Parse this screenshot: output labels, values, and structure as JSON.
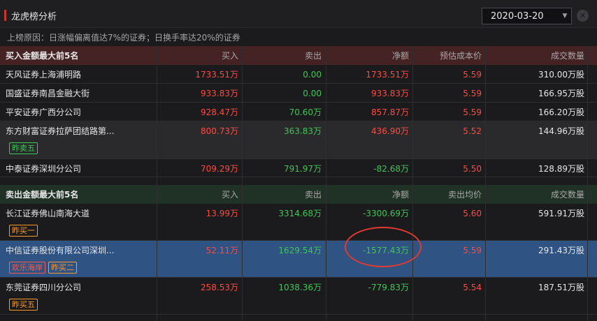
{
  "window": {
    "title": "龙虎榜分析",
    "date": "2020-03-20",
    "close_icon": "close-icon"
  },
  "reason": "上榜原因：日涨幅偏离值达7%的证券；日换手率达20%的证券",
  "buy_section": {
    "headers": [
      "买入金额最大前5名",
      "买入",
      "卖出",
      "净额",
      "预估成本价",
      "成交数量"
    ],
    "rows": [
      {
        "name": "天风证券上海浦明路",
        "buy": "1733.51万",
        "sell": "0.00",
        "net": "1733.51万",
        "price": "5.59",
        "volume": "310.00万股",
        "tags": []
      },
      {
        "name": "国盛证券南昌金融大街",
        "buy": "933.83万",
        "sell": "0.00",
        "net": "933.83万",
        "price": "5.59",
        "volume": "166.95万股",
        "tags": []
      },
      {
        "name": "平安证券广西分公司",
        "buy": "928.47万",
        "sell": "70.60万",
        "net": "857.87万",
        "price": "5.59",
        "volume": "166.20万股",
        "tags": []
      },
      {
        "name": "东方财富证券拉萨团结路第...",
        "buy": "800.73万",
        "sell": "363.83万",
        "net": "436.90万",
        "price": "5.52",
        "volume": "144.96万股",
        "tags": [
          "昨卖五"
        ]
      },
      {
        "name": "中泰证券深圳分公司",
        "buy": "709.29万",
        "sell": "791.97万",
        "net": "-82.68万",
        "price": "5.50",
        "volume": "128.89万股",
        "tags": []
      }
    ]
  },
  "sell_section": {
    "headers": [
      "卖出金额最大前5名",
      "买入",
      "卖出",
      "净额",
      "卖出均价",
      "成交数量"
    ],
    "rows": [
      {
        "name": "长江证券佛山南海大道",
        "buy": "13.99万",
        "sell": "3314.68万",
        "net": "-3300.69万",
        "price": "5.60",
        "volume": "591.91万股",
        "tags": [
          "昨买一"
        ]
      },
      {
        "name": "中信证券股份有限公司深圳...",
        "buy": "52.11万",
        "sell": "1629.54万",
        "net": "-1577.43万",
        "price": "5.59",
        "volume": "291.43万股",
        "tags": [
          "欢乐海岸",
          "昨买二"
        ]
      },
      {
        "name": "东莞证券四川分公司",
        "buy": "258.53万",
        "sell": "1038.36万",
        "net": "-779.83万",
        "price": "5.54",
        "volume": "187.51万股",
        "tags": [
          "昨买五"
        ]
      }
    ]
  }
}
